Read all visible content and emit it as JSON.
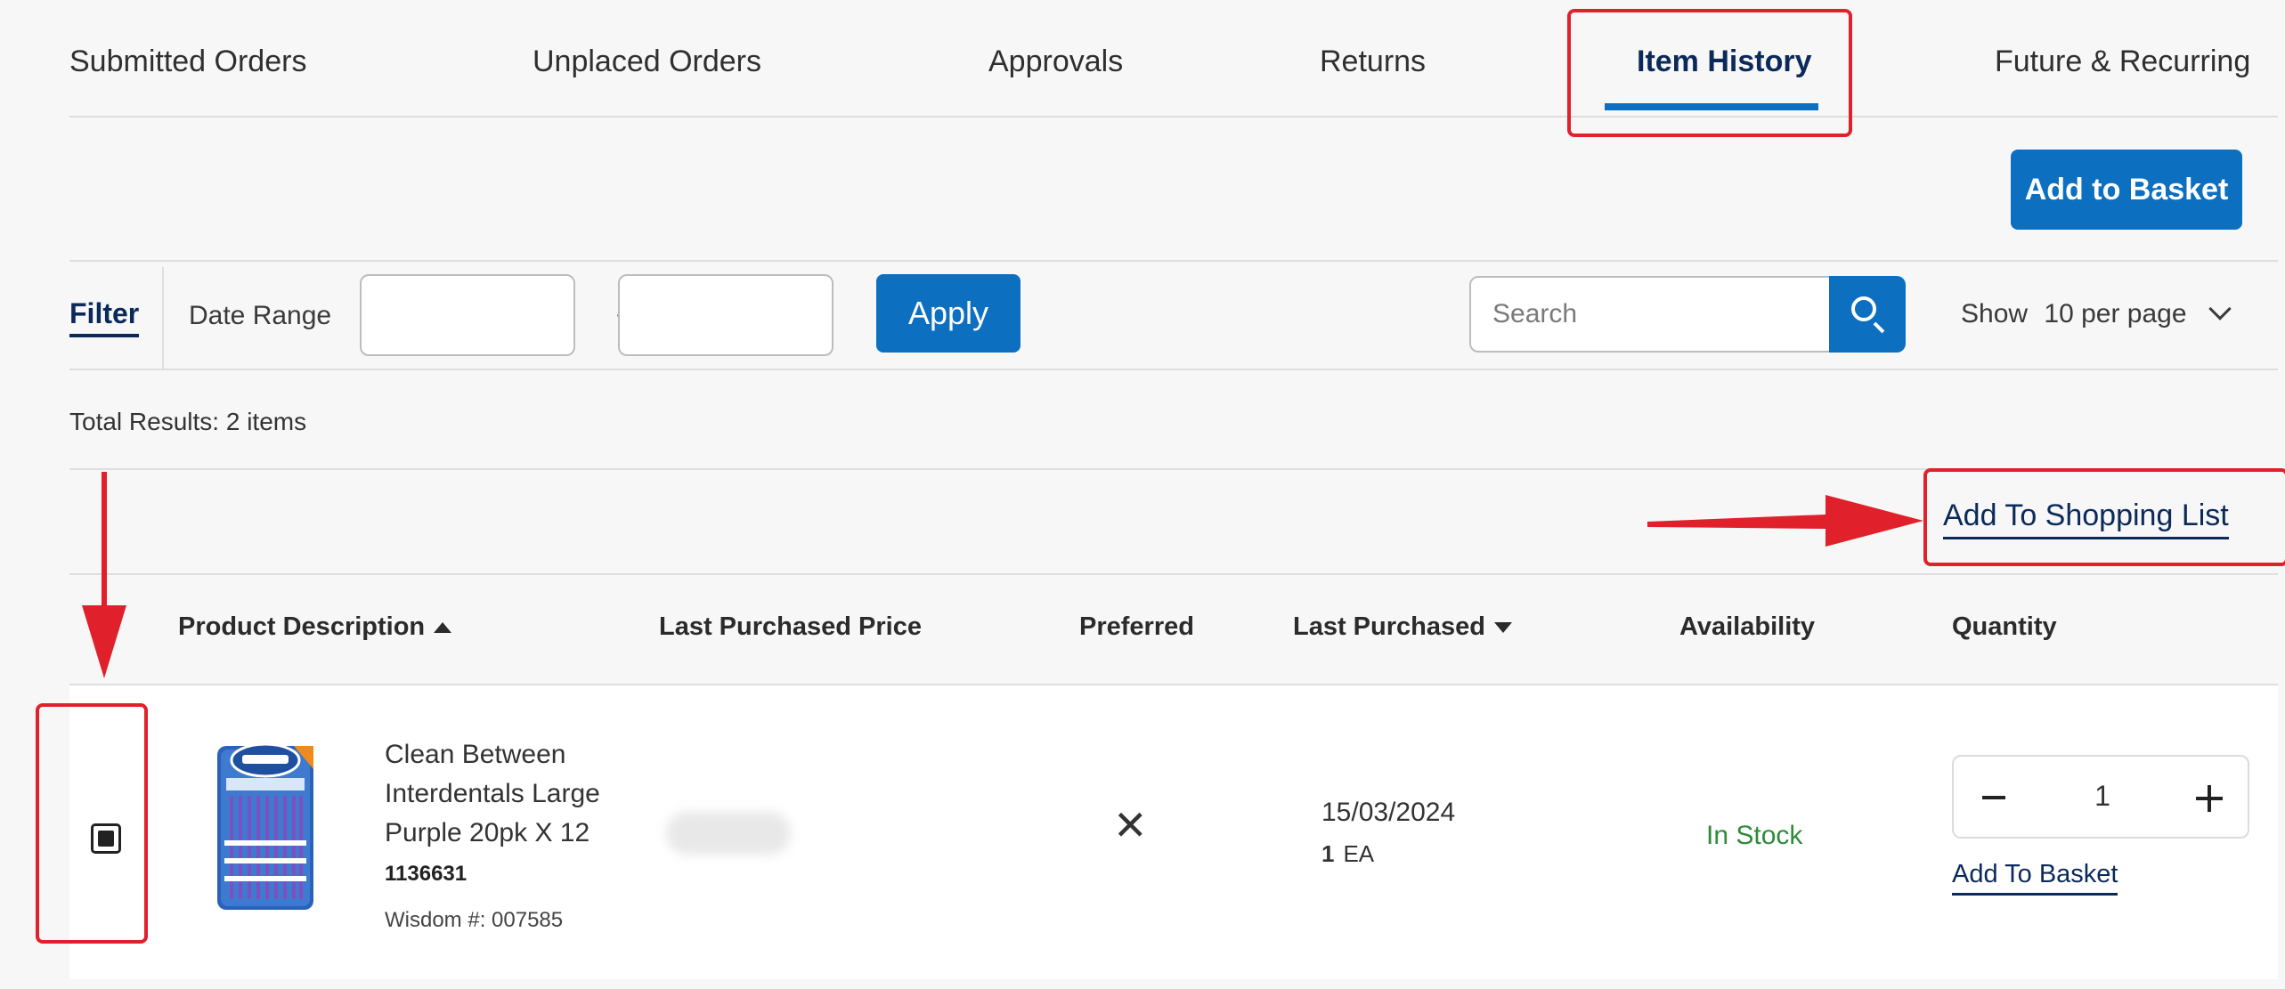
{
  "tabs": [
    {
      "label": "Submitted Orders"
    },
    {
      "label": "Unplaced Orders"
    },
    {
      "label": "Approvals"
    },
    {
      "label": "Returns"
    },
    {
      "label": "Item History",
      "active": true
    },
    {
      "label": "Future & Recurring"
    }
  ],
  "toolbar": {
    "add_to_basket": "Add to Basket"
  },
  "filter": {
    "filter_label": "Filter",
    "date_range_label": "Date Range",
    "date_from": "",
    "date_to": "",
    "separator": "-",
    "apply_label": "Apply",
    "search_placeholder": "Search",
    "show_label": "Show",
    "per_page_value": "10 per page"
  },
  "results": {
    "total_text": "Total Results: 2 items",
    "add_to_shopping_list": "Add To Shopping List"
  },
  "table": {
    "columns": [
      "Product Description",
      "Last Purchased Price",
      "Preferred",
      "Last Purchased",
      "Availability",
      "Quantity"
    ],
    "rows": [
      {
        "selected": true,
        "name": "Clean Between Interdentals Large Purple 20pk X 12",
        "sku": "1136631",
        "wisdom_no": "Wisdom #: 007585",
        "preferred": "✕",
        "last_purchased_date": "15/03/2024",
        "last_purchased_qty": "1",
        "last_purchased_unit": "EA",
        "availability": "In Stock",
        "quantity": "1",
        "add_to_basket": "Add To Basket"
      }
    ]
  },
  "colors": {
    "primary": "#0d6fbf",
    "navy": "#0b2a5a",
    "in_stock": "#2e8b3a",
    "annotation": "#e0202a"
  },
  "icons": [
    "calendar-icon",
    "search-icon",
    "chevron-down-icon",
    "sort-up-icon",
    "sort-down-icon",
    "minus-icon",
    "plus-icon"
  ]
}
